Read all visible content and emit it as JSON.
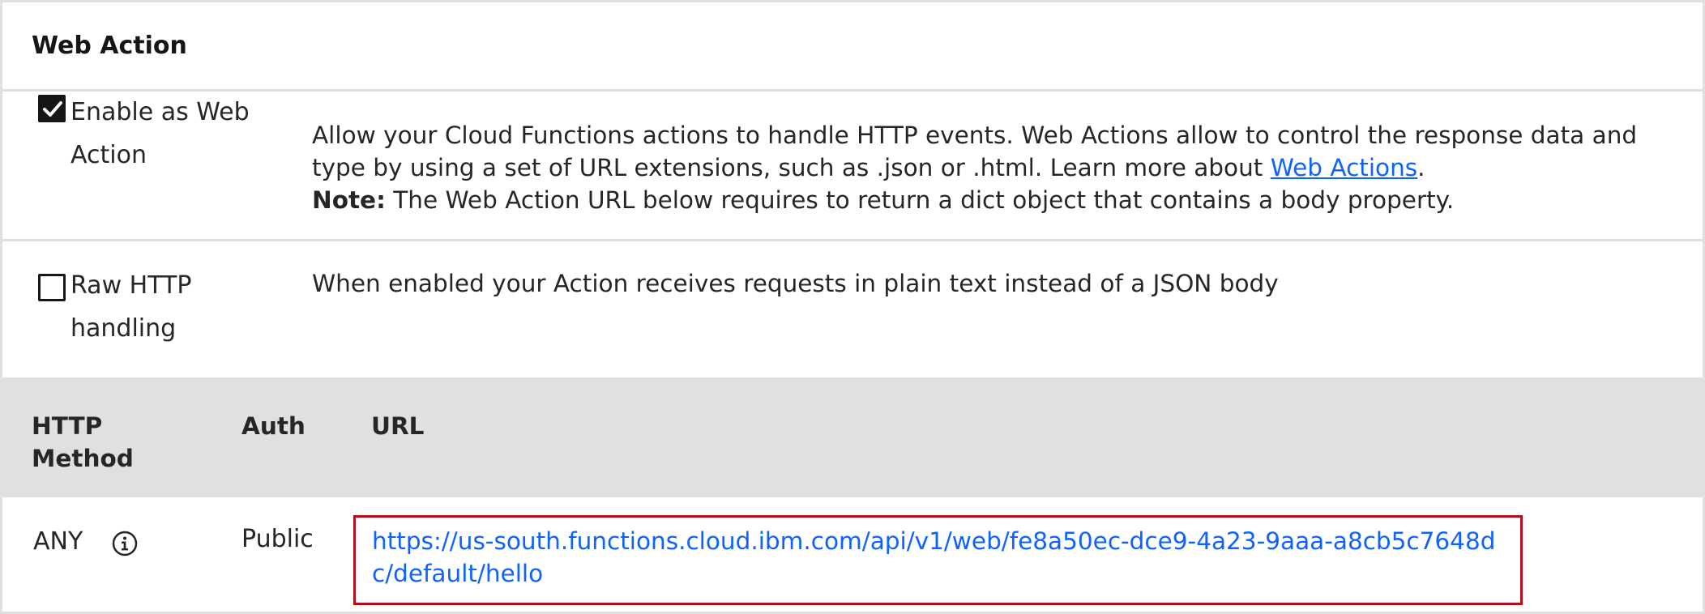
{
  "section": {
    "title": "Web Action"
  },
  "options": [
    {
      "label": "Enable as Web Action",
      "checked": true,
      "description_part1": "Allow your Cloud Functions actions to handle HTTP events. Web Actions allow to control the response data and type by using a set of URL extensions, such as .json or .html. Learn more about ",
      "link_text": "Web Actions",
      "description_part2": ".",
      "note_label": "Note:",
      "note_text": " The Web Action URL below requires to return a dict object that contains a body property."
    },
    {
      "label": "Raw HTTP handling",
      "checked": false,
      "description": "When enabled your Action receives requests in plain text instead of a JSON body"
    }
  ],
  "table": {
    "headers": {
      "method": "HTTP Method",
      "auth": "Auth",
      "url": "URL"
    },
    "rows": [
      {
        "method": "ANY",
        "info_icon": "info-icon",
        "auth": "Public",
        "url": "https://us-south.functions.cloud.ibm.com/api/v1/web/fe8a50ec-dce9-4a23-9aaa-a8cb5c7648dc/default/hello"
      }
    ]
  },
  "colors": {
    "link": "#0f62fe",
    "highlight_border": "#b50d1c",
    "table_header_bg": "#e0e0e0",
    "divider": "#e0e0e0"
  },
  "icons": {
    "checkbox_checked": "checkmark-icon",
    "info": "info-icon"
  }
}
